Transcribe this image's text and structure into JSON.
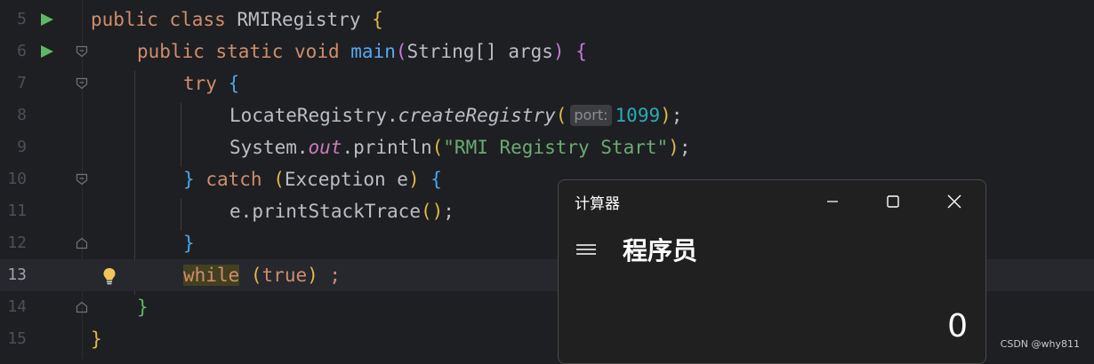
{
  "editor": {
    "current_line": 13,
    "line_numbers": [
      "5",
      "6",
      "7",
      "8",
      "9",
      "10",
      "11",
      "12",
      "13",
      "14",
      "15"
    ],
    "tokens": {
      "public": "public",
      "class": "class",
      "class_name": "RMIRegistry",
      "brace_open": "{",
      "brace_close": "}",
      "static": "static",
      "void": "void",
      "main": "main",
      "paren_open": "(",
      "paren_close": ")",
      "string_type": "String",
      "array_brackets": "[]",
      "args": "args",
      "try": "try",
      "locate_registry": "LocateRegistry",
      "dot": ".",
      "create_registry": "createRegistry",
      "param_hint": "port:",
      "port_value": "1099",
      "semicolon": ";",
      "system": "System",
      "out": "out",
      "println": "println",
      "string_literal": "\"RMI Registry Start\"",
      "catch": "catch",
      "exception_type": "Exception",
      "e": "e",
      "print_stack_trace": "printStackTrace",
      "empty_parens": "()",
      "while": "while",
      "true": "true",
      "space_semicolon": " ;"
    }
  },
  "calculator": {
    "title": "计算器",
    "mode": "程序员",
    "display": "0",
    "menu_icon": "hamburger-icon",
    "controls": [
      "minimize-icon",
      "maximize-icon",
      "close-icon"
    ]
  },
  "watermark": "CSDN @why811",
  "colors": {
    "background": "#1e1f22",
    "keyword": "#cf8e6d",
    "string": "#6aab73",
    "number": "#2aacb8",
    "run_icon": "#5fb865",
    "calculator_bg": "#202020"
  }
}
